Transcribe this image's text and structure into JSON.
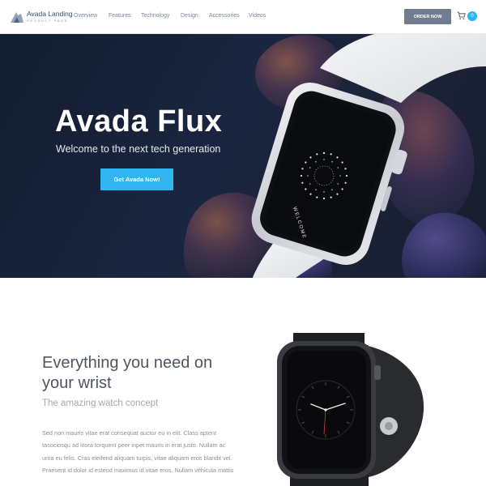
{
  "header": {
    "logo_title": "Avada Landing",
    "logo_subtitle": "PRODUCT PAGE",
    "nav": [
      "Overview",
      "Features",
      "Technology",
      "Design",
      "Accessories",
      "Videos"
    ],
    "order_button": "ORDER NOW",
    "cart_count": "0"
  },
  "hero": {
    "title": "Avada Flux",
    "subtitle": "Welcome to the next tech generation",
    "cta": "Get Avada Now!",
    "watch_screen_text": "WELCOME"
  },
  "feature": {
    "title": "Everything you need on your wrist",
    "subtitle": "The amazing watch concept",
    "body": "Sed non mauris vitae erat consequat auctor eu in elit. Class aptent tasociosqu ad litora torquent peer inpet mauris in erat justo. Nullam ac urna eu felis. Cras eleifend aliquam turpis, vitae aliquam eros blandit vel. Praesent id dolor id esteod maximus id vitae eros. Nullam vehicula mattis"
  },
  "colors": {
    "accent": "#31b5ef",
    "order_button": "#707d91",
    "hero_bg": "#1a2540"
  },
  "icons": {
    "logo": "avada-logo-icon",
    "cart": "cart-icon"
  }
}
